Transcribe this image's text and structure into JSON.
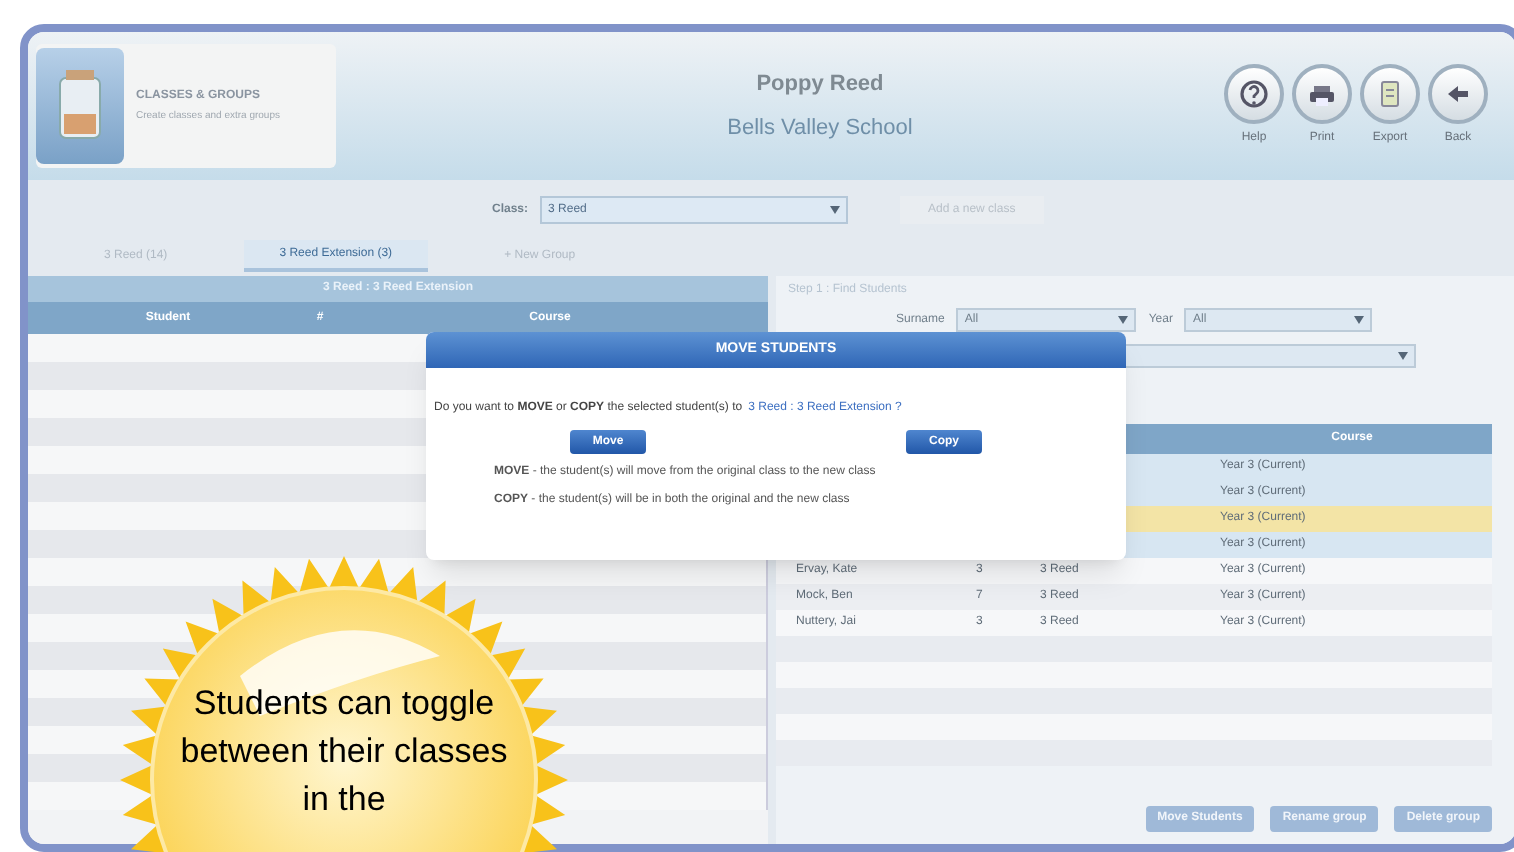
{
  "header": {
    "module_title": "CLASSES & GROUPS",
    "module_subtitle": "Create classes and extra groups",
    "teacher_name": "Poppy Reed",
    "school_name": "Bells Valley School",
    "toolbar": [
      {
        "kind": "help",
        "label": "Help"
      },
      {
        "kind": "print",
        "label": "Print"
      },
      {
        "kind": "export",
        "label": "Export"
      },
      {
        "kind": "back",
        "label": "Back"
      }
    ]
  },
  "class_filter": {
    "label": "Class:",
    "value": "3 Reed",
    "action": "Add a new class"
  },
  "tabs": [
    {
      "label": "3 Reed (14)",
      "selected": false
    },
    {
      "label": "3 Reed Extension (3)",
      "selected": true
    },
    {
      "label": "+ New Group",
      "selected": false
    }
  ],
  "left_panel": {
    "title": "3 Reed : 3 Reed Extension",
    "columns": [
      "Student",
      "#",
      "Course"
    ]
  },
  "right_panel": {
    "step": "Step 1 : Find Students",
    "surname_label": "Surname",
    "surname_value": "All",
    "year_label": "Year",
    "year_value": "All",
    "columns": [
      "Course"
    ],
    "rows": [
      {
        "course": "Year 3 (Current)",
        "selected": false
      },
      {
        "course": "Year 3 (Current)",
        "selected": false
      },
      {
        "course": "Year 3 (Current)",
        "selected": true
      },
      {
        "course": "Year 3 (Current)",
        "selected": false
      },
      {
        "name": "Ervay, Kate",
        "number": "3",
        "class": "3 Reed",
        "course": "Year 3 (Current)",
        "selected": false
      },
      {
        "name": "Mock, Ben",
        "number": "7",
        "class": "3 Reed",
        "course": "Year 3 (Current)",
        "selected": false
      },
      {
        "name": "Nuttery, Jai",
        "number": "3",
        "class": "3 Reed",
        "course": "Year 3 (Current)",
        "selected": false
      }
    ],
    "buttons": [
      "Move Students",
      "Rename group",
      "Delete group"
    ]
  },
  "dialog": {
    "title": "MOVE STUDENTS",
    "question": "Do you want to **MOVE** or **COPY** the selected student(s) to",
    "target_link": "3 Reed : 3 Reed Extension ?",
    "buttons": [
      "Move",
      "Copy"
    ],
    "notes": [
      "**MOVE** - the student(s) will move from the original class to the new class",
      "**COPY** - the student(s) will be in both the original and the new class"
    ]
  },
  "callout": {
    "text": "Students can toggle between their classes in the"
  }
}
